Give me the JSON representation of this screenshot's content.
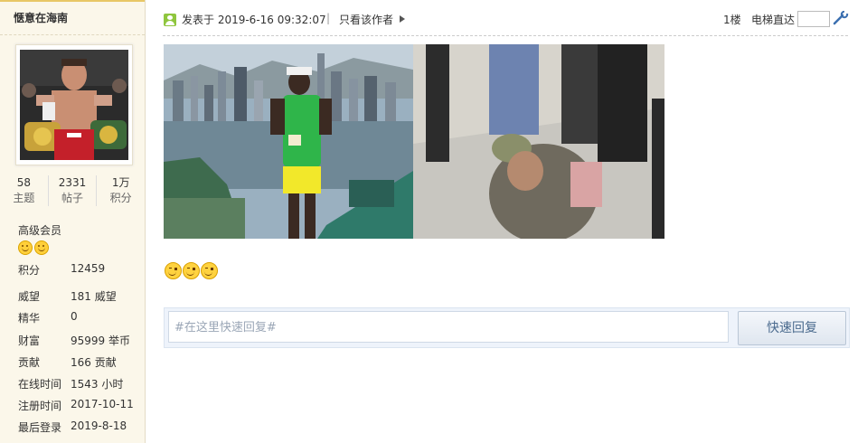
{
  "sidebar": {
    "username": "惬意在海南",
    "stats": [
      {
        "value": "58",
        "label": "主题"
      },
      {
        "value": "2331",
        "label": "帖子"
      },
      {
        "value": "1万",
        "label": "积分"
      }
    ],
    "group": "高级会员",
    "profile": [
      {
        "key": "积分",
        "value": "12459"
      },
      {
        "key": "威望",
        "value": "181 威望"
      },
      {
        "key": "精华",
        "value": "0"
      },
      {
        "key": "财富",
        "value": "95999 举币"
      },
      {
        "key": "贡献",
        "value": "166 贡献"
      },
      {
        "key": "在线时间",
        "value": "1543 小时"
      },
      {
        "key": "注册时间",
        "value": "2017-10-11"
      },
      {
        "key": "最后登录",
        "value": "2019-8-18"
      }
    ]
  },
  "post": {
    "posted_at": "发表于 2019-6-16 09:32:07",
    "separator": "|",
    "only_author": "只看该作者",
    "floor": "1楼",
    "elevator": "电梯直达"
  },
  "reply": {
    "placeholder": "#在这里快速回复#",
    "button": "快速回复"
  },
  "colors": {
    "sidebar_bg": "#fbf7ea",
    "accent": "#e8c766",
    "reply_bg": "#eef3fb"
  }
}
